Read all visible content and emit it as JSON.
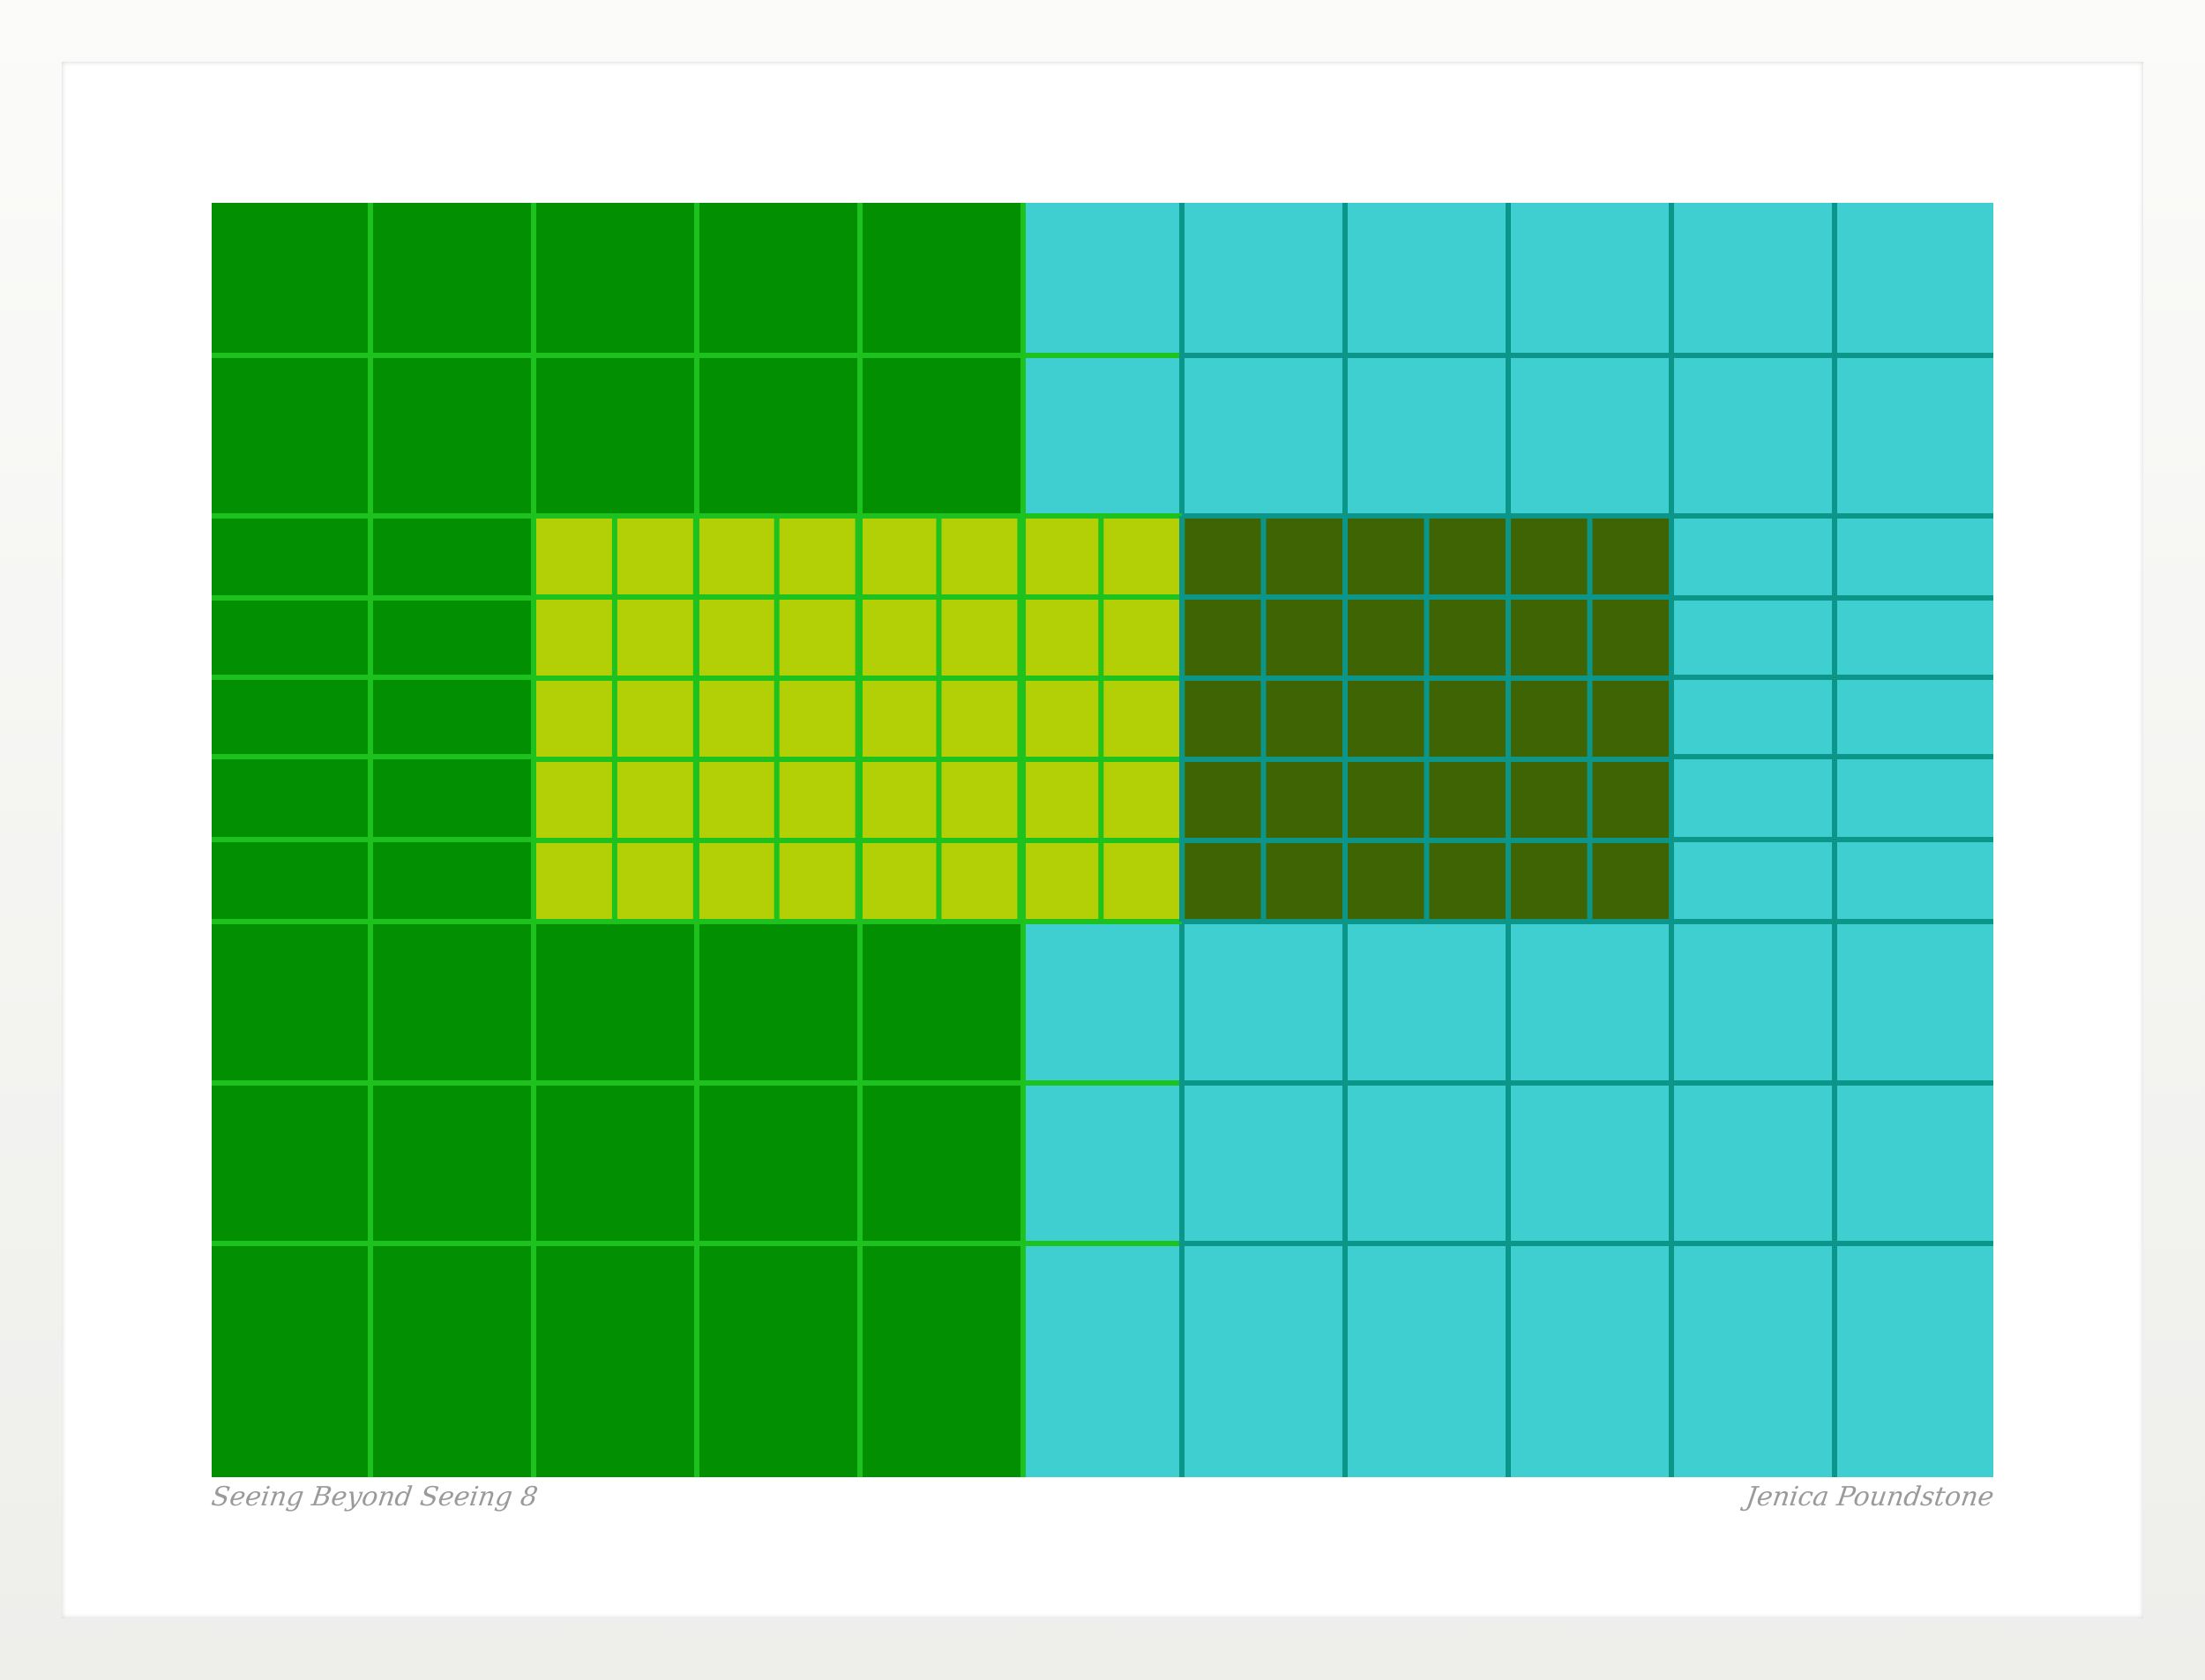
{
  "artwork": {
    "title": "Seeing Beyond Seeing 8",
    "signature": "Jenica Poundstone"
  },
  "colors": {
    "frame": "#f4f4f2",
    "mat": "#ffffff",
    "dark_green": "#028f02",
    "dark_green_lines": "#1ec21e",
    "cyan": "#3fcfd1",
    "cyan_lines": "#0c968a",
    "lime": "#b3d006",
    "lime_lines": "#1ec21e",
    "olive": "#3e6403",
    "olive_lines": "#0c968a"
  }
}
